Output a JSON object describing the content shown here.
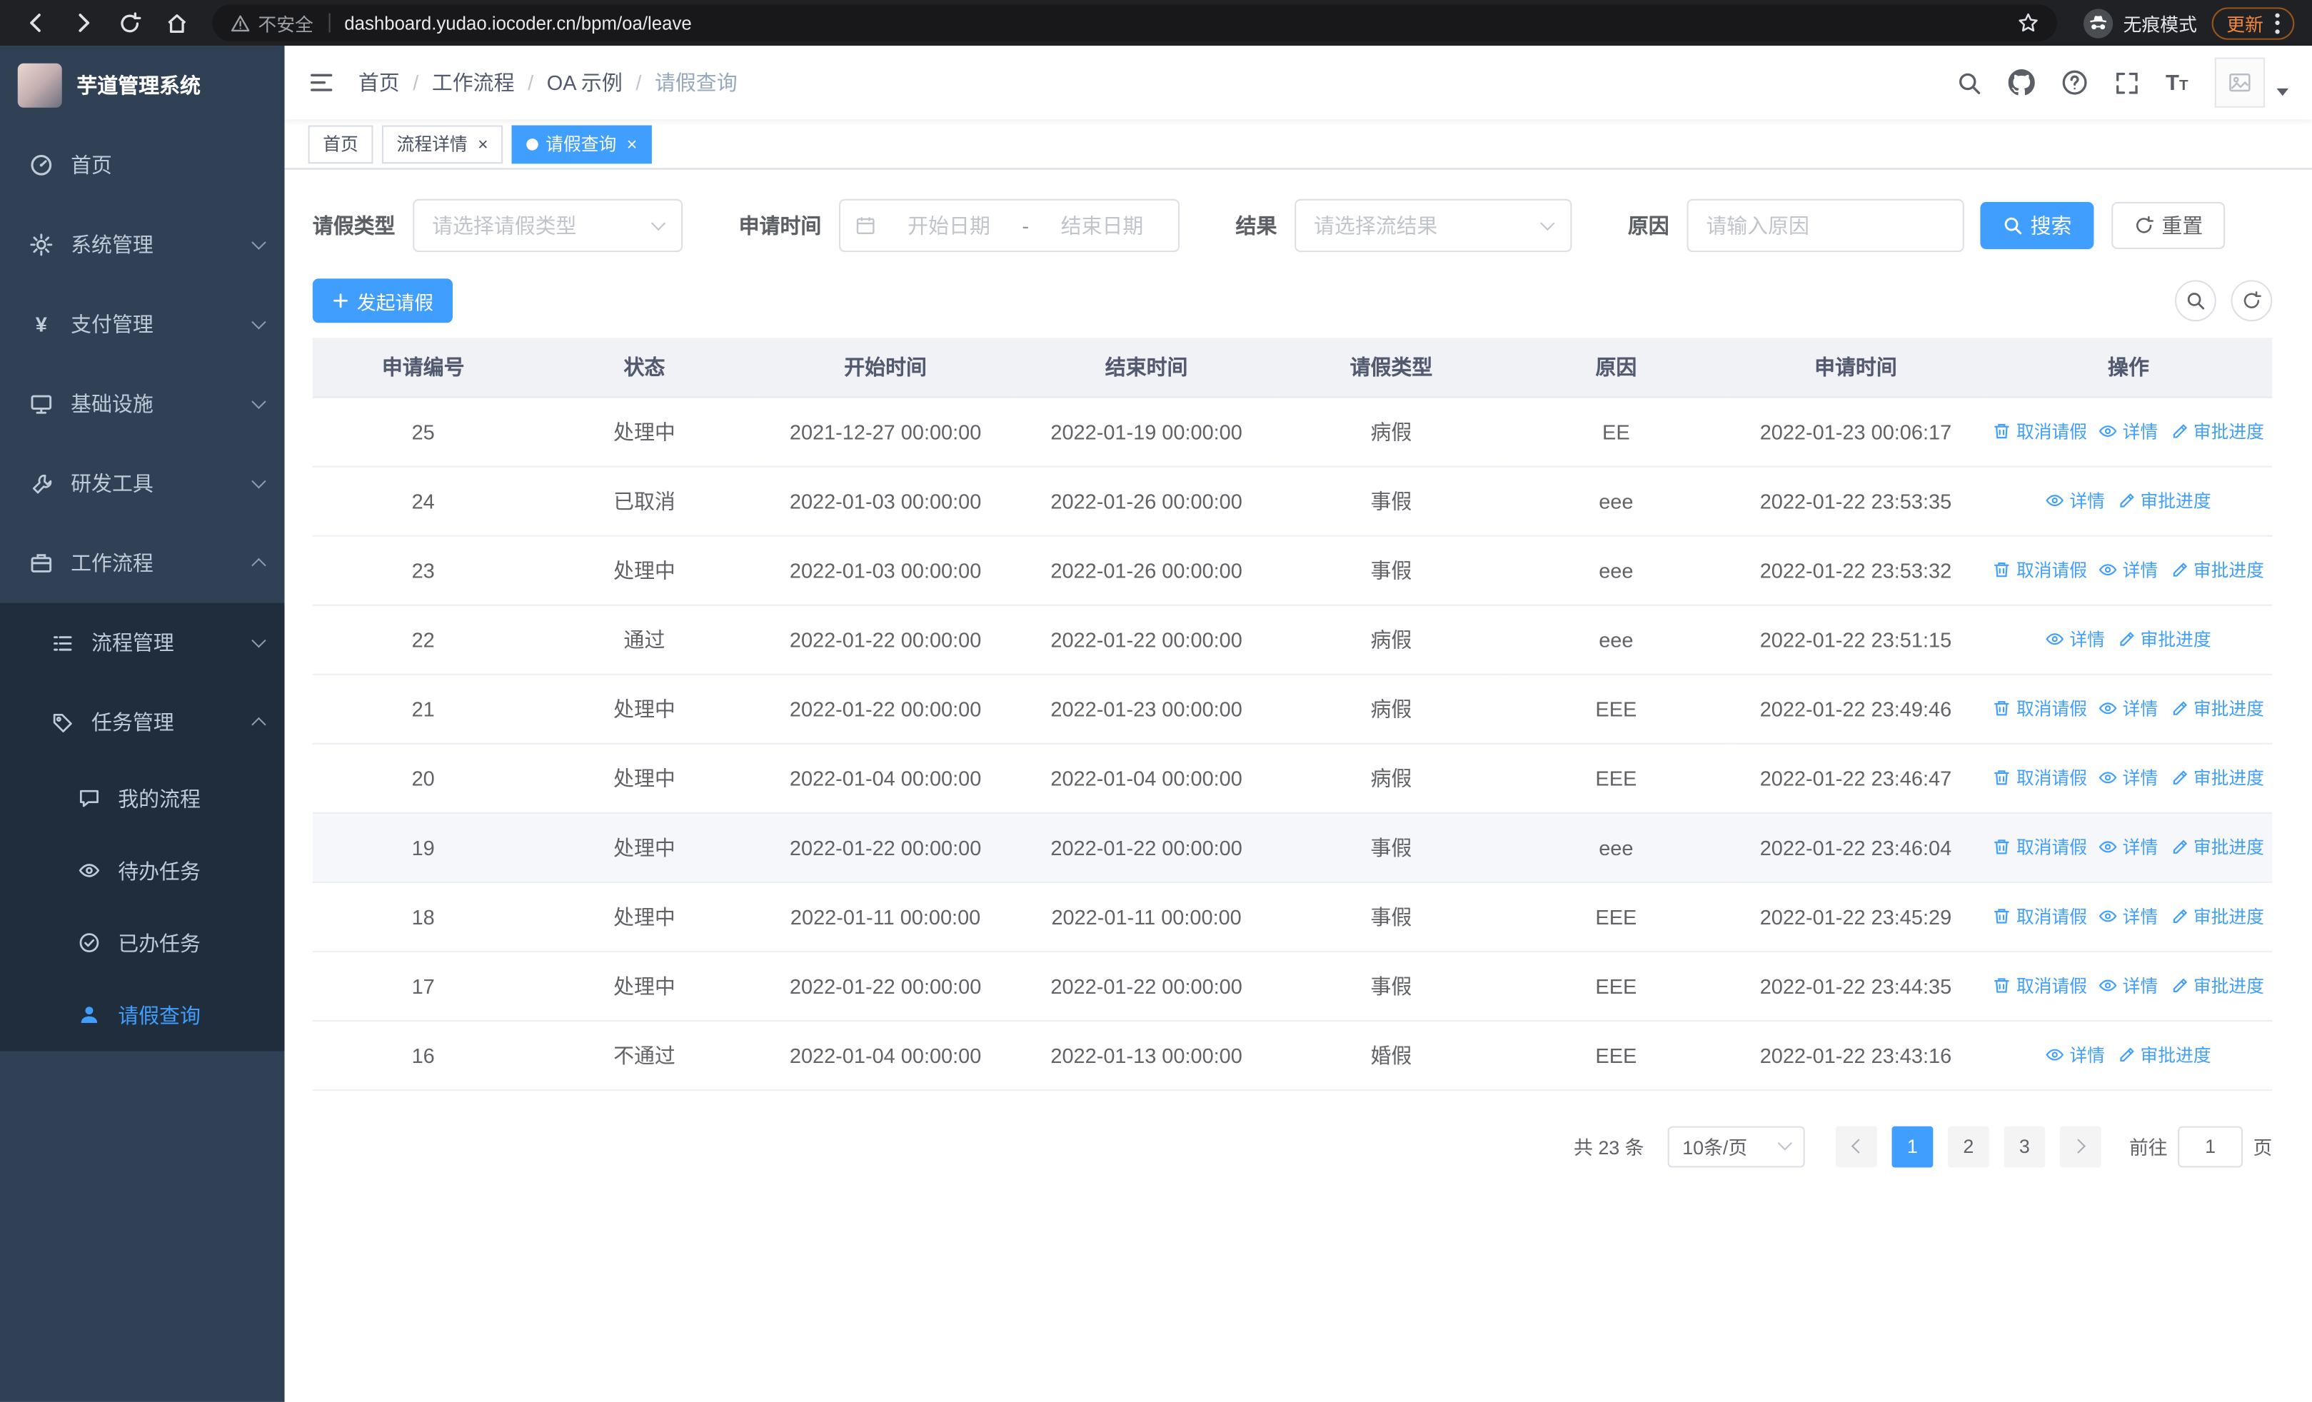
{
  "colors": {
    "primary": "#409eff",
    "sidebar_bg": "#304156",
    "sidebar_submenu_bg": "#1f2d3d",
    "browser_chrome_bg": "#202124",
    "update_chip": "#f0883e"
  },
  "browser": {
    "security_label": "不安全",
    "url": "dashboard.yudao.iocoder.cn/bpm/oa/leave",
    "incognito_label": "无痕模式",
    "update_label": "更新"
  },
  "sidebar": {
    "app_title": "芋道管理系统",
    "items": [
      {
        "label": "首页"
      },
      {
        "label": "系统管理"
      },
      {
        "label": "支付管理"
      },
      {
        "label": "基础设施"
      },
      {
        "label": "研发工具"
      },
      {
        "label": "工作流程"
      }
    ],
    "submenu": [
      {
        "label": "流程管理"
      },
      {
        "label": "任务管理"
      }
    ],
    "task_items": [
      {
        "label": "我的流程"
      },
      {
        "label": "待办任务"
      },
      {
        "label": "已办任务"
      },
      {
        "label": "请假查询"
      }
    ]
  },
  "header": {
    "breadcrumb": [
      "首页",
      "工作流程",
      "OA 示例",
      "请假查询"
    ],
    "separator": "/"
  },
  "tabs": [
    {
      "label": "首页"
    },
    {
      "label": "流程详情"
    },
    {
      "label": "请假查询"
    }
  ],
  "filters": {
    "leave_type_label": "请假类型",
    "leave_type_placeholder": "请选择请假类型",
    "apply_time_label": "申请时间",
    "start_date_placeholder": "开始日期",
    "date_separator": "-",
    "end_date_placeholder": "结束日期",
    "result_label": "结果",
    "result_placeholder": "请选择流结果",
    "reason_label": "原因",
    "reason_placeholder": "请输入原因",
    "search_label": "搜索",
    "reset_label": "重置"
  },
  "toolbar": {
    "create_label": "发起请假"
  },
  "table": {
    "columns": [
      "申请编号",
      "状态",
      "开始时间",
      "结束时间",
      "请假类型",
      "原因",
      "申请时间",
      "操作"
    ],
    "action_labels": {
      "cancel": "取消请假",
      "detail": "详情",
      "progress": "审批进度"
    },
    "rows": [
      {
        "id": "25",
        "status": "处理中",
        "start": "2021-12-27 00:00:00",
        "end": "2022-01-19 00:00:00",
        "type": "病假",
        "reason": "EE",
        "applied": "2022-01-23 00:06:17",
        "actions": [
          "cancel",
          "detail",
          "progress"
        ],
        "highlighted": false
      },
      {
        "id": "24",
        "status": "已取消",
        "start": "2022-01-03 00:00:00",
        "end": "2022-01-26 00:00:00",
        "type": "事假",
        "reason": "eee",
        "applied": "2022-01-22 23:53:35",
        "actions": [
          "detail",
          "progress"
        ],
        "highlighted": false
      },
      {
        "id": "23",
        "status": "处理中",
        "start": "2022-01-03 00:00:00",
        "end": "2022-01-26 00:00:00",
        "type": "事假",
        "reason": "eee",
        "applied": "2022-01-22 23:53:32",
        "actions": [
          "cancel",
          "detail",
          "progress"
        ],
        "highlighted": false
      },
      {
        "id": "22",
        "status": "通过",
        "start": "2022-01-22 00:00:00",
        "end": "2022-01-22 00:00:00",
        "type": "病假",
        "reason": "eee",
        "applied": "2022-01-22 23:51:15",
        "actions": [
          "detail",
          "progress"
        ],
        "highlighted": false
      },
      {
        "id": "21",
        "status": "处理中",
        "start": "2022-01-22 00:00:00",
        "end": "2022-01-23 00:00:00",
        "type": "病假",
        "reason": "EEE",
        "applied": "2022-01-22 23:49:46",
        "actions": [
          "cancel",
          "detail",
          "progress"
        ],
        "highlighted": false
      },
      {
        "id": "20",
        "status": "处理中",
        "start": "2022-01-04 00:00:00",
        "end": "2022-01-04 00:00:00",
        "type": "病假",
        "reason": "EEE",
        "applied": "2022-01-22 23:46:47",
        "actions": [
          "cancel",
          "detail",
          "progress"
        ],
        "highlighted": false
      },
      {
        "id": "19",
        "status": "处理中",
        "start": "2022-01-22 00:00:00",
        "end": "2022-01-22 00:00:00",
        "type": "事假",
        "reason": "eee",
        "applied": "2022-01-22 23:46:04",
        "actions": [
          "cancel",
          "detail",
          "progress"
        ],
        "highlighted": true
      },
      {
        "id": "18",
        "status": "处理中",
        "start": "2022-01-11 00:00:00",
        "end": "2022-01-11 00:00:00",
        "type": "事假",
        "reason": "EEE",
        "applied": "2022-01-22 23:45:29",
        "actions": [
          "cancel",
          "detail",
          "progress"
        ],
        "highlighted": false
      },
      {
        "id": "17",
        "status": "处理中",
        "start": "2022-01-22 00:00:00",
        "end": "2022-01-22 00:00:00",
        "type": "事假",
        "reason": "EEE",
        "applied": "2022-01-22 23:44:35",
        "actions": [
          "cancel",
          "detail",
          "progress"
        ],
        "highlighted": false
      },
      {
        "id": "16",
        "status": "不通过",
        "start": "2022-01-04 00:00:00",
        "end": "2022-01-13 00:00:00",
        "type": "婚假",
        "reason": "EEE",
        "applied": "2022-01-22 23:43:16",
        "actions": [
          "detail",
          "progress"
        ],
        "highlighted": false
      }
    ]
  },
  "pagination": {
    "total_label": "共 23 条",
    "page_size_label": "10条/页",
    "pages": [
      "1",
      "2",
      "3"
    ],
    "active_page": "1",
    "goto_label": "前往",
    "goto_value": "1",
    "page_unit_label": "页"
  }
}
